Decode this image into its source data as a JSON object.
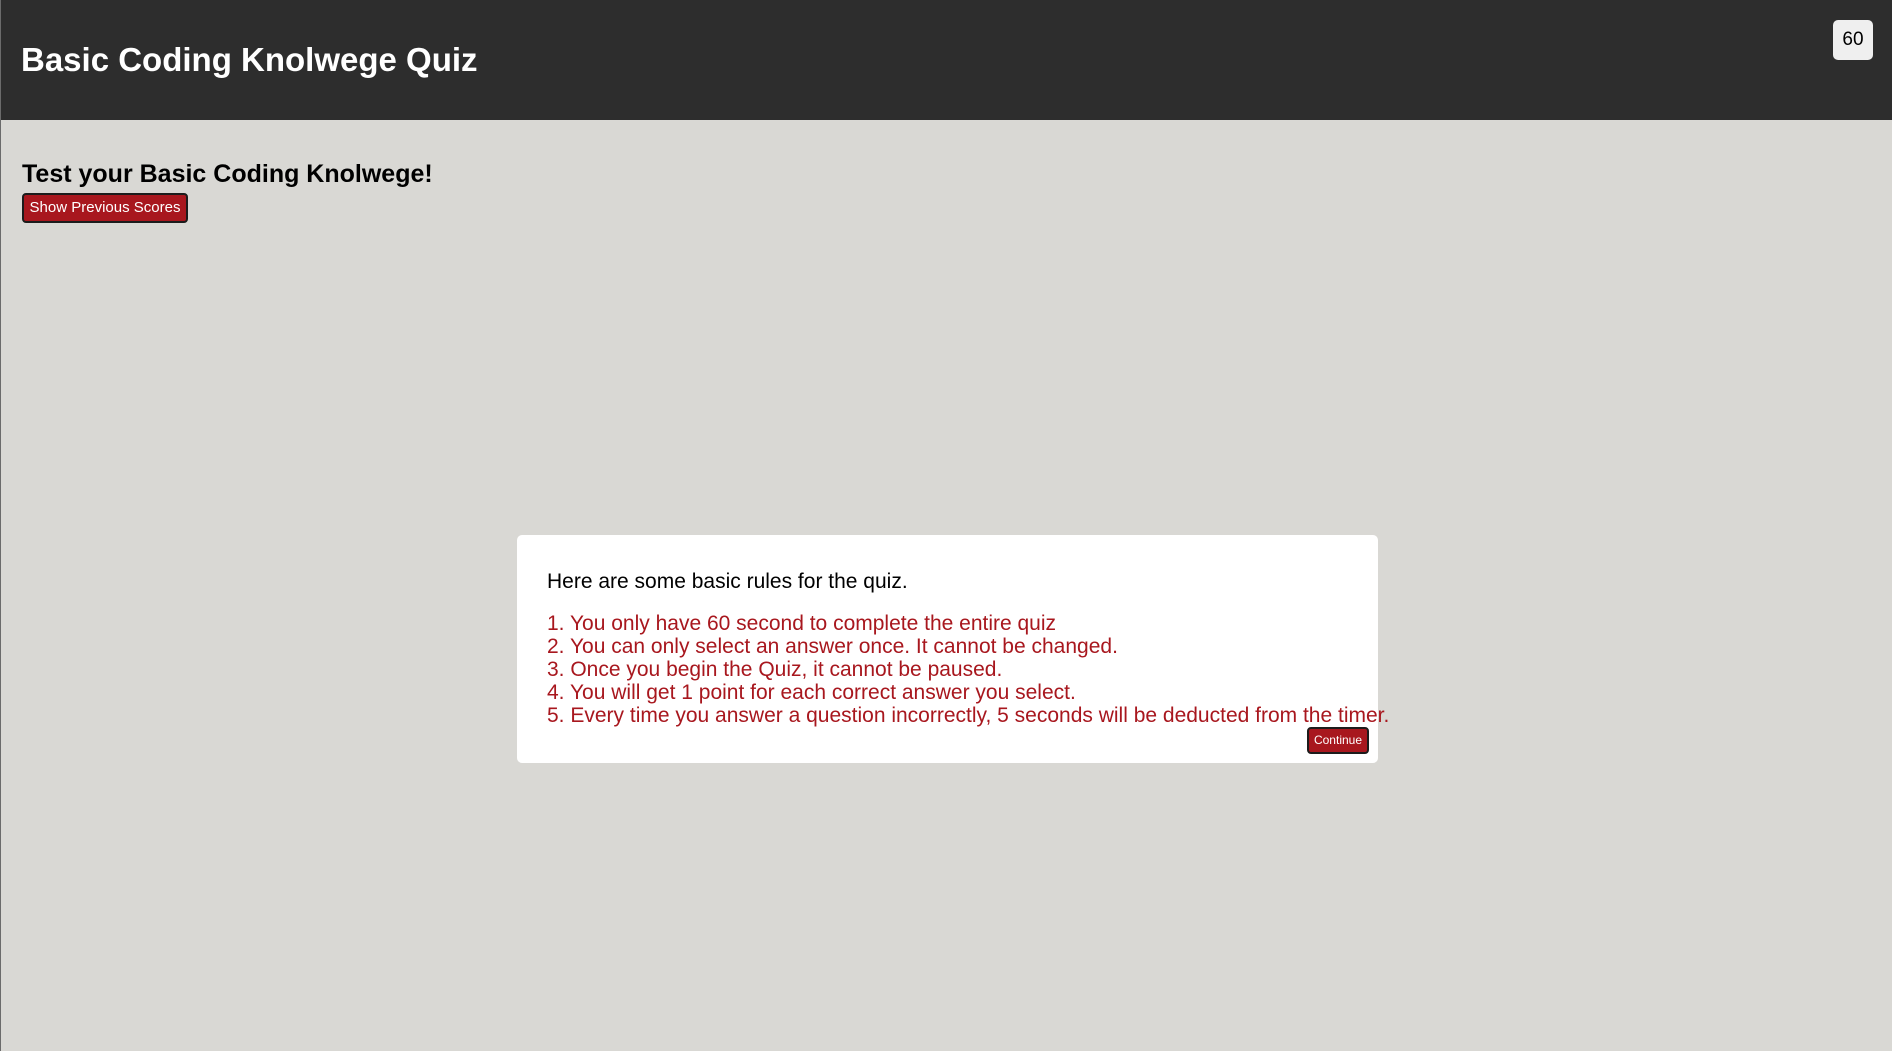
{
  "header": {
    "title": "Basic Coding Knolwege Quiz",
    "timer": "60"
  },
  "main": {
    "subtitle": "Test your Basic Coding Knolwege!",
    "show_scores_label": "Show Previous Scores"
  },
  "modal": {
    "intro": "Here are some basic rules for the quiz.",
    "rules": [
      "1. You only have 60 second to complete the entire quiz",
      "2. You can only select an answer once. It cannot be changed.",
      "3. Once you begin the Quiz, it cannot be paused.",
      "4. You will get 1 point for each correct answer you select.",
      "5. Every time you answer a question incorrectly, 5 seconds will be deducted from the timer."
    ],
    "continue_label": "Continue"
  },
  "colors": {
    "header_bg": "#2d2d2d",
    "page_bg": "#d9d8d4",
    "accent": "#a8171e",
    "modal_bg": "#ffffff"
  }
}
